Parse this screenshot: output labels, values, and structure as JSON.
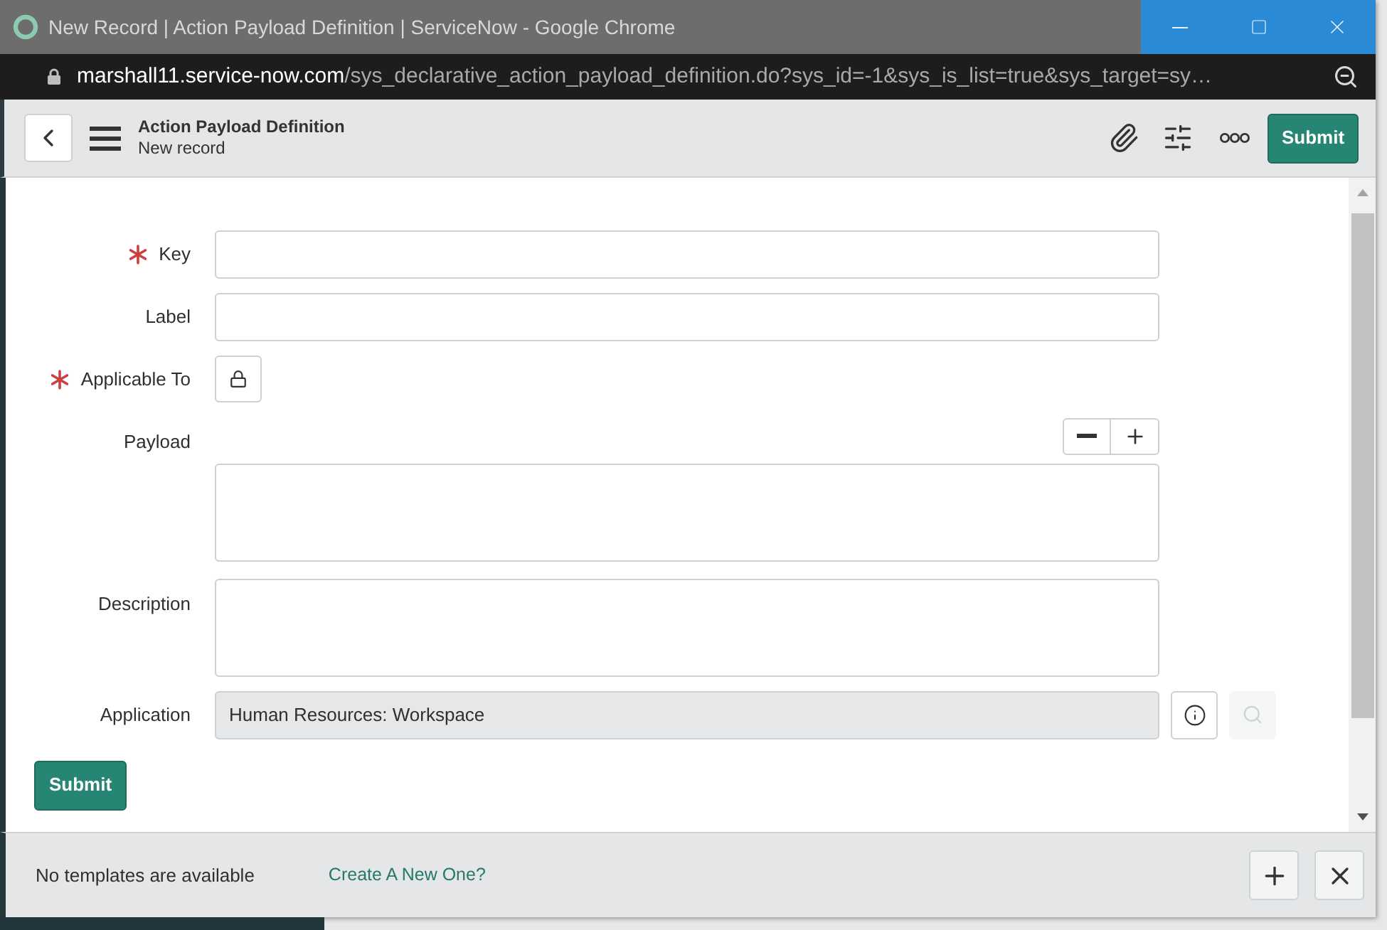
{
  "window": {
    "title": "New Record | Action Payload Definition | ServiceNow - Google Chrome"
  },
  "address_bar": {
    "domain": "marshall11.service-now.com",
    "path": "/sys_declarative_action_payload_definition.do?sys_id=-1&sys_is_list=true&sys_target=sy…"
  },
  "header": {
    "title": "Action Payload Definition",
    "subtitle": "New record",
    "submit": "Submit"
  },
  "form": {
    "fields": [
      {
        "kind": "text",
        "label": "Key",
        "required": true
      },
      {
        "kind": "text",
        "label": "Label",
        "required": false
      },
      {
        "kind": "lock",
        "label": "Applicable To",
        "required": true
      },
      {
        "kind": "script",
        "label": "Payload",
        "required": false
      },
      {
        "kind": "textarea",
        "label": "Description",
        "required": false
      },
      {
        "kind": "reference",
        "label": "Application",
        "required": false,
        "value": "Human Resources: Workspace",
        "read_only": true,
        "search_disabled": true
      }
    ],
    "submit": "Submit"
  },
  "footer": {
    "message": "No templates are available",
    "link": "Create A New One?"
  }
}
